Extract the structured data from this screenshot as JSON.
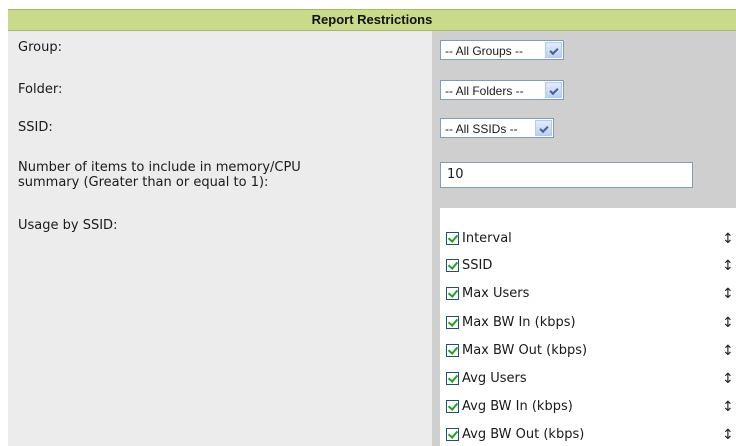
{
  "header": {
    "title": "Report Restrictions"
  },
  "fields": {
    "group_label": "Group:",
    "folder_label": "Folder:",
    "ssid_label": "SSID:",
    "items_label_line1": "Number of items to include in memory/CPU",
    "items_label_line2": "summary (Greater than or equal to 1):",
    "usage_label": "Usage by SSID:"
  },
  "selects": {
    "group_value": "-- All Groups --",
    "folder_value": "-- All Folders --",
    "ssid_value": "-- All SSIDs --"
  },
  "inputs": {
    "items_value": "10"
  },
  "usage_columns": [
    {
      "label": "Interval",
      "checked": true
    },
    {
      "label": "SSID",
      "checked": true
    },
    {
      "label": "Max Users",
      "checked": true
    },
    {
      "label": "Max BW In (kbps)",
      "checked": true
    },
    {
      "label": "Max BW Out (kbps)",
      "checked": true
    },
    {
      "label": "Avg Users",
      "checked": true
    },
    {
      "label": "Avg BW In (kbps)",
      "checked": true
    },
    {
      "label": "Avg BW Out (kbps)",
      "checked": true
    }
  ],
  "icons": {
    "drag_handle": "↕",
    "checkbox": "checkbox-checked-icon",
    "dropdown": "chevron-down-icon"
  }
}
